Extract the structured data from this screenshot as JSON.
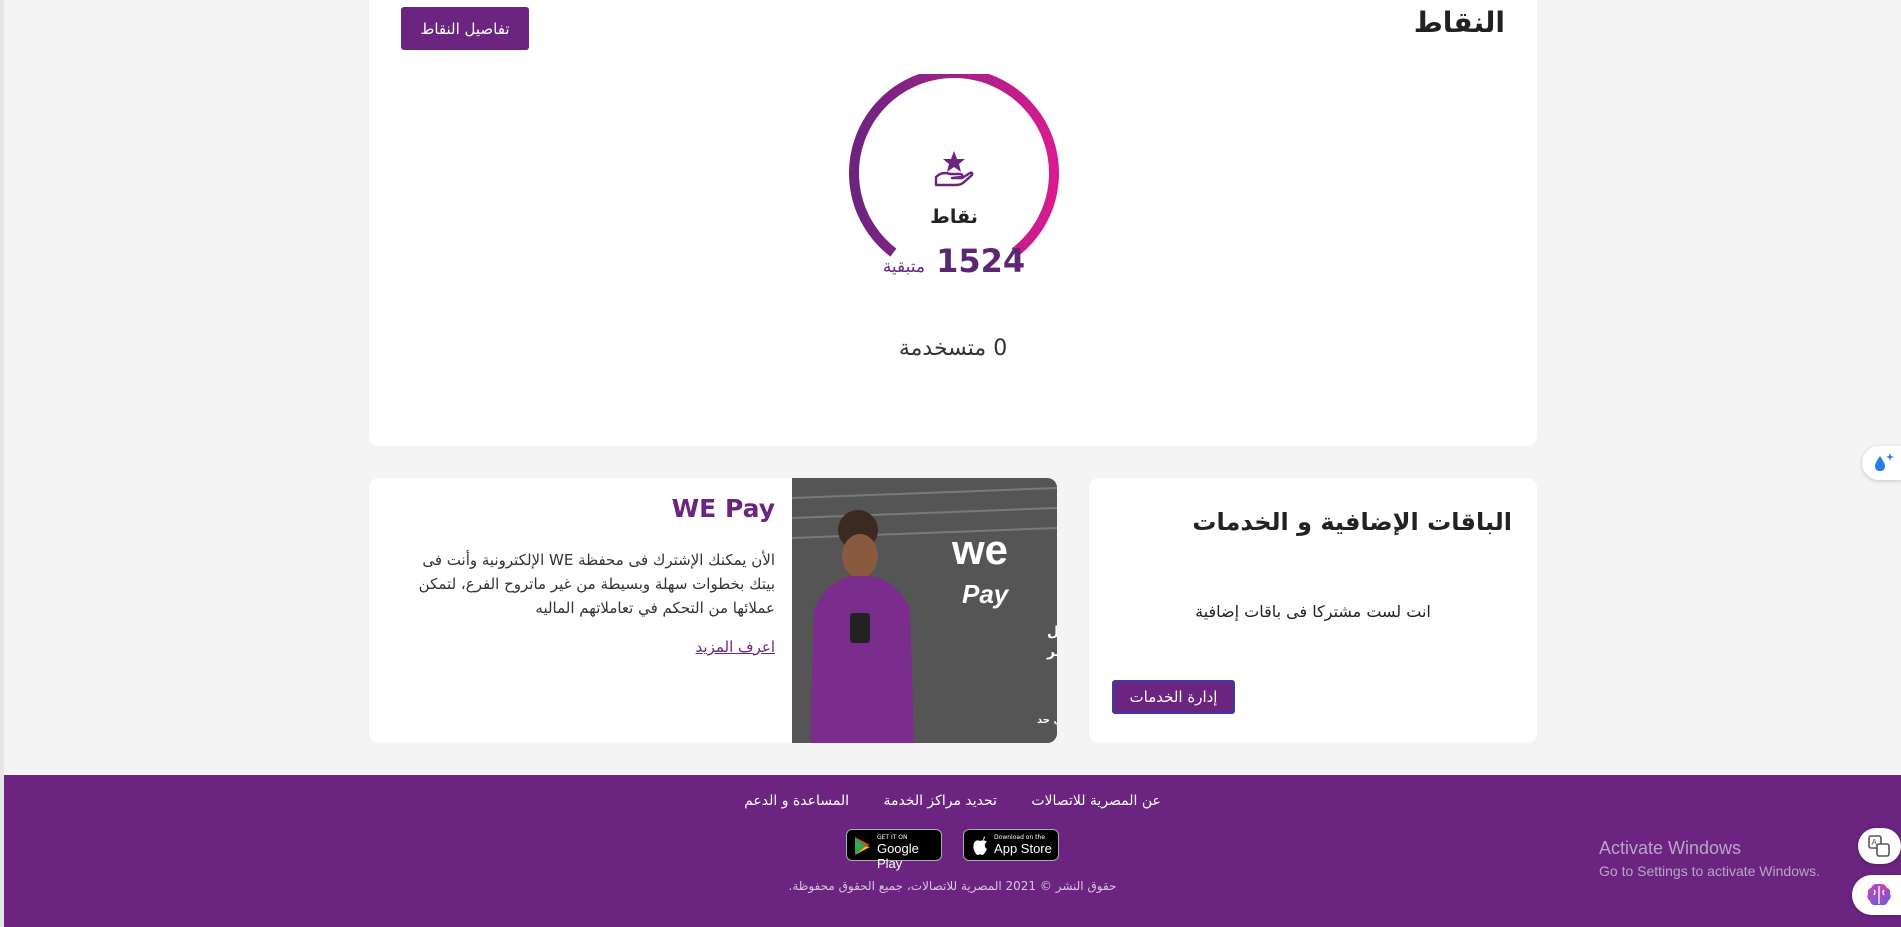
{
  "points": {
    "title": "النقاط",
    "details_button": "تفاصيل النقاط",
    "gauge": {
      "label": "نقاط",
      "remaining_value": "1524",
      "remaining_label": "متبقية"
    },
    "used_text": "0 متسخدمة"
  },
  "services": {
    "title": "الباقات الإضافية و الخدمات",
    "empty_message": "انت لست مشتركا فى باقات إضافية",
    "manage_button": "إدارة الخدمات"
  },
  "wepay": {
    "title": "WE Pay",
    "description": "الأن يمكنك الإشترك فى محفظة WE الإلكترونية وأنت فى بيتك بخطوات سهلة وبسيطة من غير ماتروح الفرع، لتمكن عملائها من التحكم في تعاملاتهم الماليه",
    "learn_more": "اعرف المزيد",
    "image_text": {
      "brand": "we",
      "pay": "Pay",
      "line1": "استـلام وتحويــل",
      "line2": "وخدمات تانية كتير",
      "tagline": "قبل أي حد"
    }
  },
  "footer": {
    "links": [
      "عن المصرية للاتصالات",
      "تحديد مراكز الخدمة",
      "المساعدة و الدعم"
    ],
    "google_play": {
      "small": "GET IT ON",
      "big": "Google Play"
    },
    "app_store": {
      "small": "Download on the",
      "big": "App Store"
    },
    "copyright": "حقوق النشر © 2021 المصرية للاتصالات، جميع الحقوق محفوظة."
  },
  "windows_watermark": {
    "line1": "Activate Windows",
    "line2": "Go to Settings to activate Windows."
  },
  "colors": {
    "brand_purple": "#6b2480",
    "gauge_start": "#6b2480",
    "gauge_end": "#d81b8f"
  }
}
